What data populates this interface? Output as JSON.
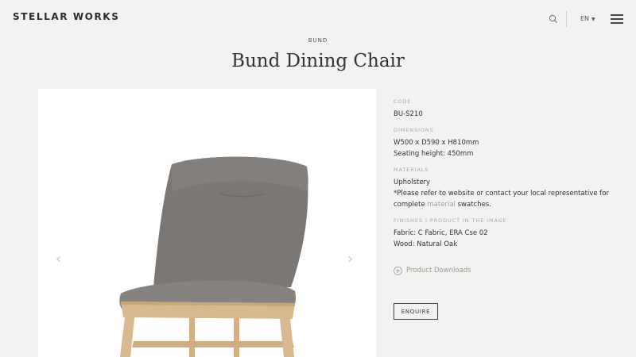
{
  "header": {
    "logo": "STELLAR WORKS",
    "language": "EN"
  },
  "product": {
    "collection": "BUND",
    "title": "Bund Dining Chair"
  },
  "gallery": {
    "prev_icon": "chevron-left-icon",
    "next_icon": "chevron-right-icon"
  },
  "specs": {
    "code_label": "CODE",
    "code": "BU-S210",
    "dimensions_label": "DIMENSIONS",
    "dimensions_line1": "W500 x D590 x H810mm",
    "dimensions_line2": "Seating height: 450mm",
    "materials_label": "MATERIALS",
    "materials_line1": "Upholstery",
    "materials_line2": "*Please refer to website or contact your local representative for",
    "materials_line3_pre": "complete ",
    "materials_link": "material",
    "materials_line3_post": " swatches.",
    "finishes_label": "FINISHES  |  PRODUCT IN THE IMAGE",
    "finishes_line1": "Fabric: C Fabric, ERA Cse 02",
    "finishes_line2": "Wood: Natural Oak"
  },
  "downloads_label": "Product Downloads",
  "enquire_label": "ENQUIRE",
  "colors": {
    "background": "#f3f2f0",
    "fabric": "#7b7775",
    "wood": "#d8b88e"
  }
}
